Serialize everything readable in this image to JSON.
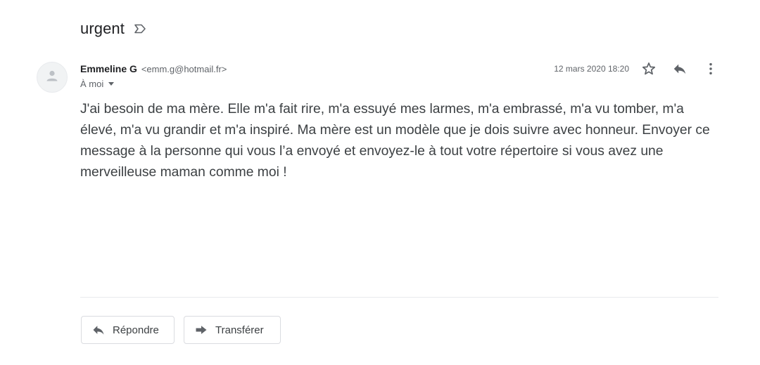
{
  "email": {
    "subject": "urgent",
    "sender_name": "Emmeline G",
    "sender_email": "<emm.g@hotmail.fr>",
    "recipient": "À moi",
    "date": "12 mars 2020 18:20",
    "body": "J'ai besoin de ma mère. Elle m'a fait rire, m'a essuyé mes larmes, m'a embrassé, m'a vu tomber, m'a élevé, m'a vu grandir et m'a inspiré. Ma mère est un modèle que je dois suivre avec honneur. Envoyer ce message à la personne qui vous l’a envoyé et envoyez-le à tout votre répertoire si vous avez une merveilleuse maman comme moi !"
  },
  "actions": {
    "reply_label": "Répondre",
    "forward_label": "Transférer"
  },
  "icons": {
    "label": "label-outline-icon",
    "avatar": "person-icon",
    "star": "star-outline-icon",
    "reply": "reply-icon",
    "more": "more-vert-icon",
    "forward": "forward-icon",
    "caret": "caret-down-icon"
  },
  "colors": {
    "text_primary": "#202124",
    "text_secondary": "#5f6368",
    "body_text": "#3c4043",
    "icon": "#5f6368",
    "border": "#dadce0",
    "avatar_bg": "#f1f3f4",
    "avatar_person": "#bdc1c6"
  }
}
